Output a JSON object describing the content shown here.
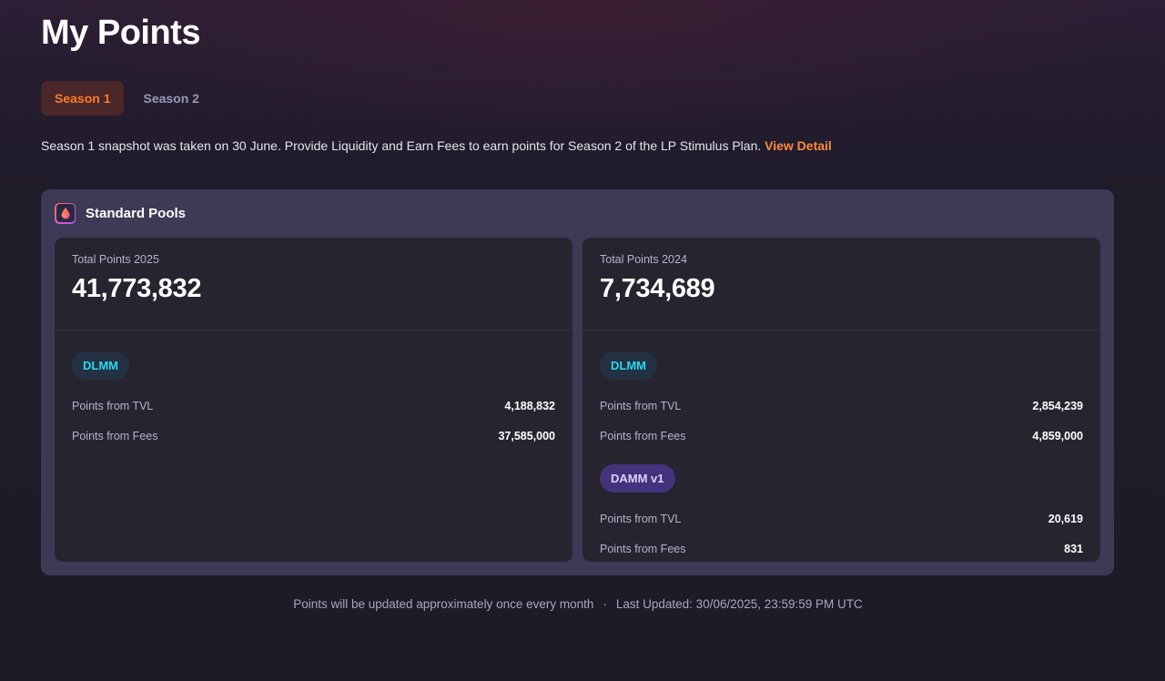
{
  "page": {
    "title": "My Points"
  },
  "tabs": [
    {
      "label": "Season 1",
      "active": true
    },
    {
      "label": "Season 2",
      "active": false
    }
  ],
  "notice": {
    "text": "Season 1 snapshot was taken on 30 June. Provide Liquidity and Earn Fees to earn points for Season 2 of the LP Stimulus Plan.",
    "link": "View Detail"
  },
  "panel": {
    "title": "Standard Pools",
    "icon": "droplet-icon"
  },
  "cards": [
    {
      "label": "Total Points 2025",
      "total": "41,773,832",
      "groups": [
        {
          "badge": "DLMM",
          "rows": [
            {
              "label": "Points from TVL",
              "value": "4,188,832"
            },
            {
              "label": "Points from Fees",
              "value": "37,585,000"
            }
          ]
        }
      ]
    },
    {
      "label": "Total Points 2024",
      "total": "7,734,689",
      "groups": [
        {
          "badge": "DLMM",
          "rows": [
            {
              "label": "Points from TVL",
              "value": "2,854,239"
            },
            {
              "label": "Points from Fees",
              "value": "4,859,000"
            }
          ]
        },
        {
          "badge": "DAMM v1",
          "rows": [
            {
              "label": "Points from TVL",
              "value": "20,619"
            },
            {
              "label": "Points from Fees",
              "value": "831"
            }
          ]
        }
      ]
    }
  ],
  "footer": {
    "update_note": "Points will be updated approximately once every month",
    "separator": "·",
    "last_updated": "Last Updated: 30/06/2025, 23:59:59 PM UTC"
  },
  "colors": {
    "accent": "#ff7a2a",
    "dlmm": "#28d8f0",
    "damm": "#dcd0ff"
  }
}
